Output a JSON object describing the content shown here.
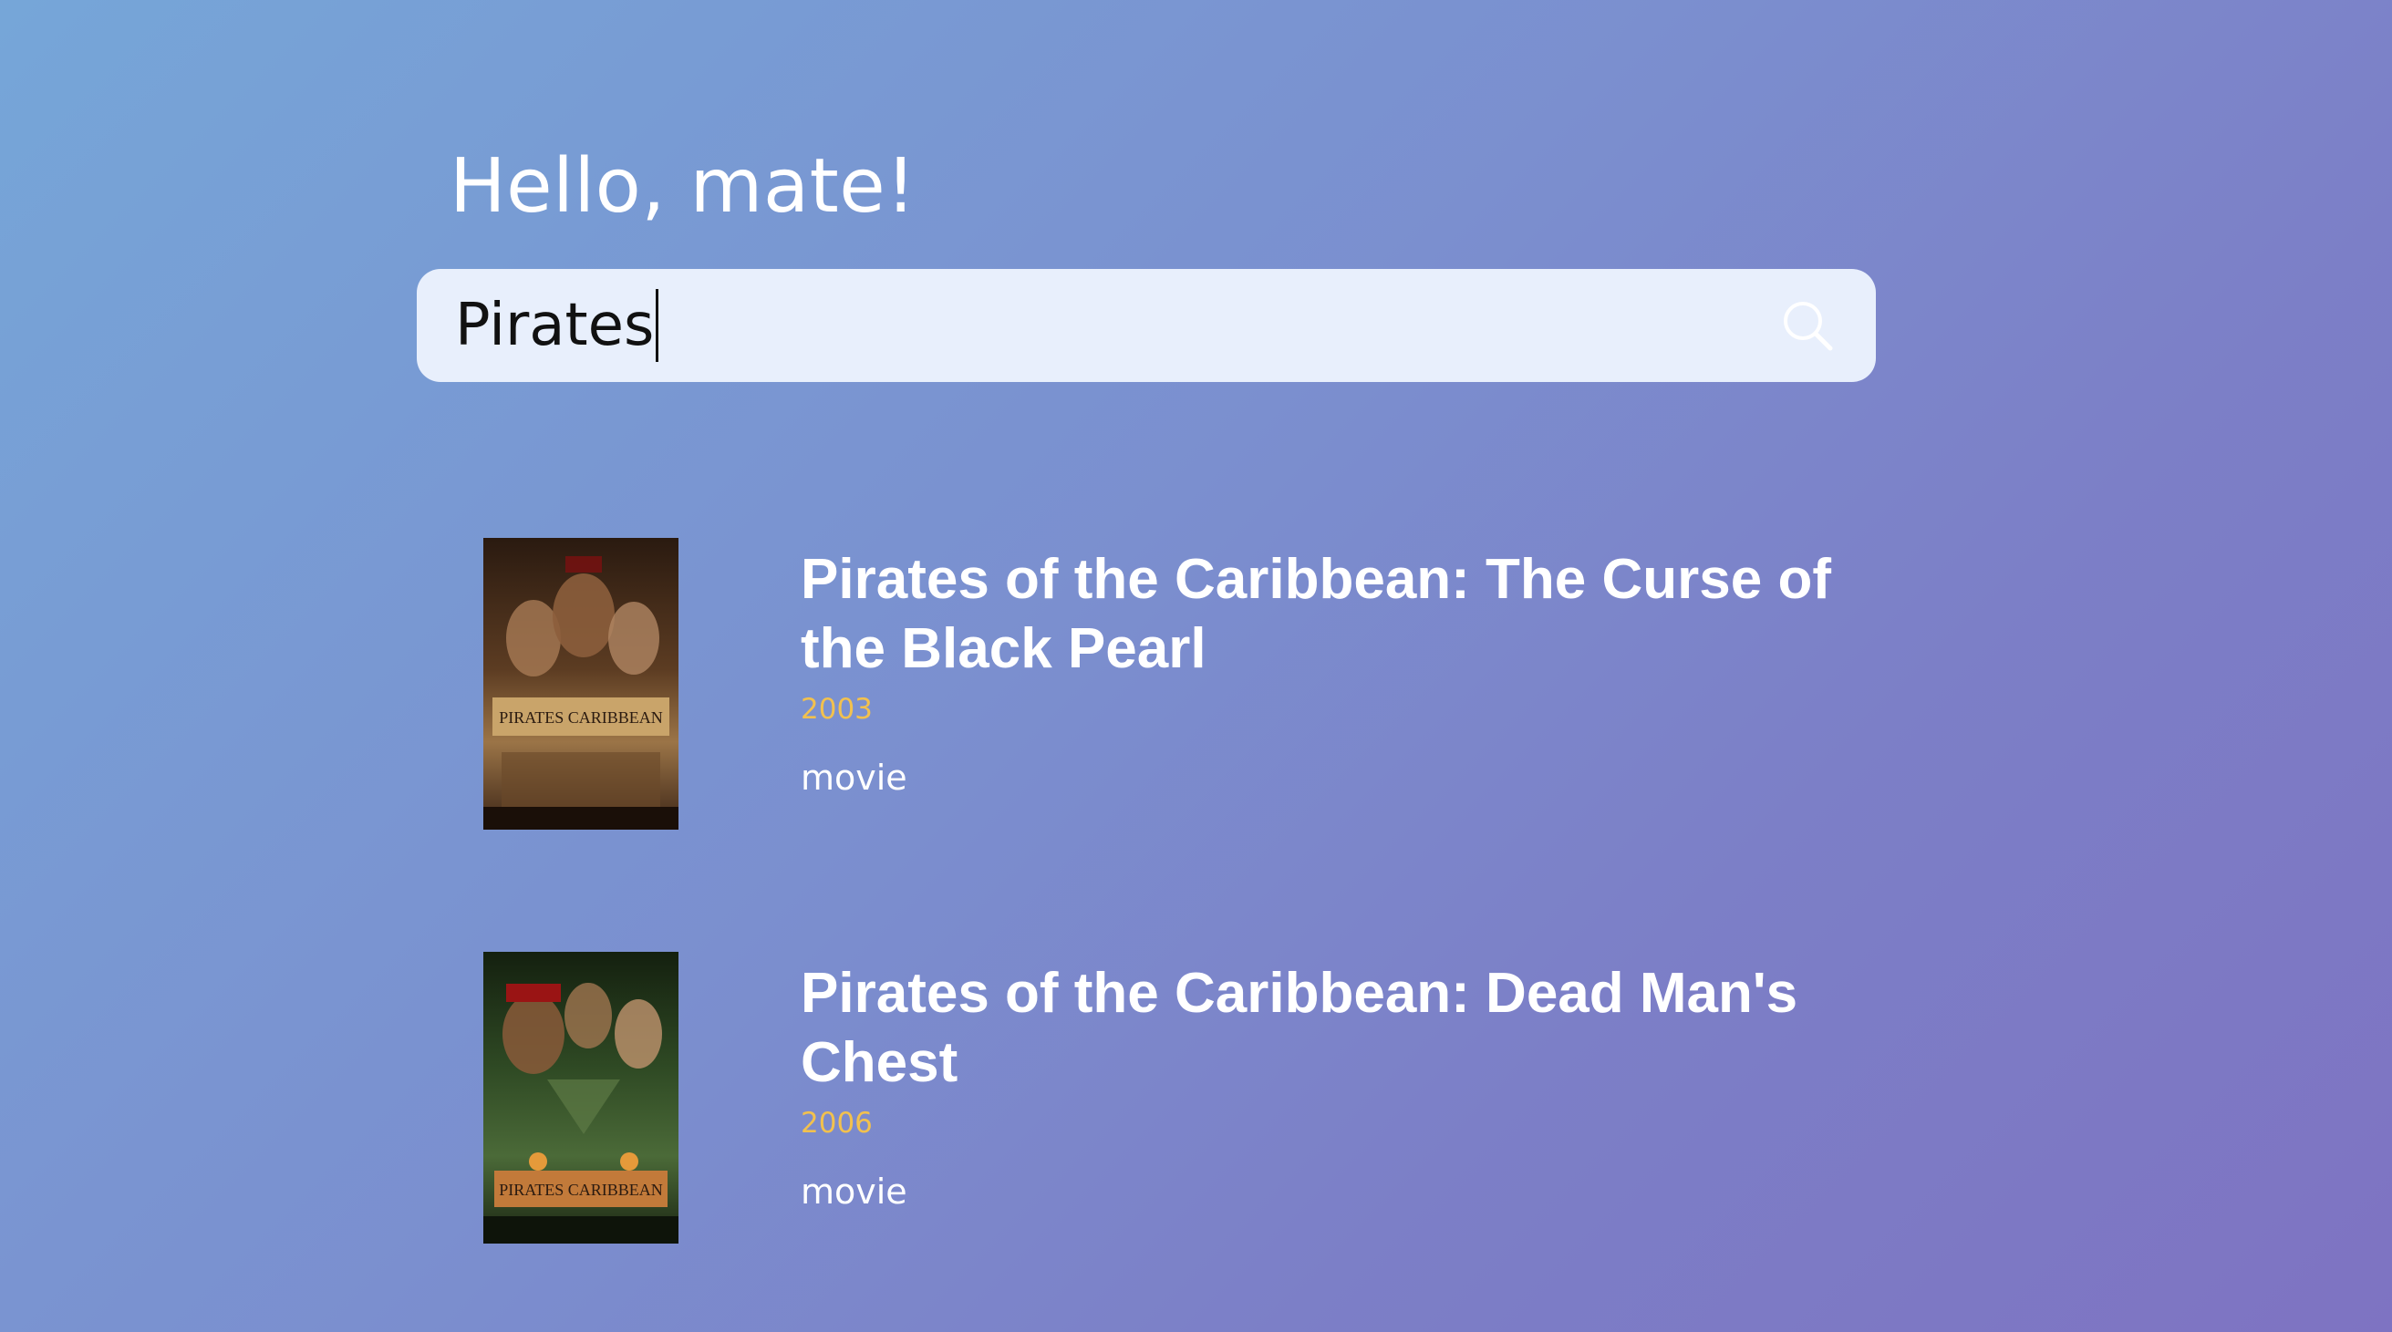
{
  "greeting": "Hello, mate!",
  "search": {
    "value": "Pirates",
    "icon": "search-icon"
  },
  "results": [
    {
      "title": "Pirates of the Caribbean: The Curse of the Black Pearl",
      "year": "2003",
      "type": "movie",
      "poster_text": "PIRATES CARIBBEAN",
      "poster_colors": [
        "#3a2416",
        "#8a6a3c",
        "#c9a46a"
      ]
    },
    {
      "title": "Pirates of the Caribbean: Dead Man's Chest",
      "year": "2006",
      "type": "movie",
      "poster_text": "PIRATES CARIBBEAN",
      "poster_colors": [
        "#1f2a1a",
        "#3f5a2e",
        "#c27a3a"
      ]
    }
  ],
  "colors": {
    "accent_year": "#f2c14e",
    "search_bg": "#e8effc"
  }
}
